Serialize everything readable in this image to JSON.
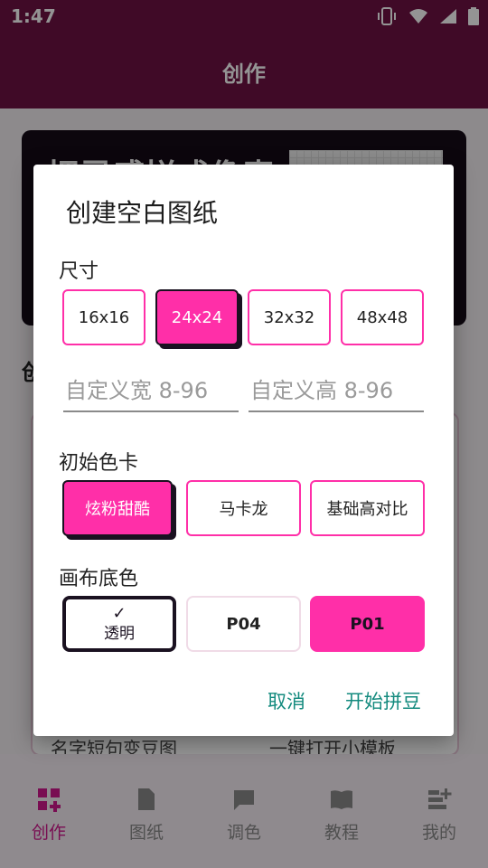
{
  "status": {
    "time": "1:47"
  },
  "app": {
    "title": "创作"
  },
  "background": {
    "hero_text": "把灵感拼成像素",
    "section_heading": "创",
    "card_left": "名字短句变豆图",
    "card_right": "一键打开小模板"
  },
  "dialog": {
    "title": "创建空白图纸",
    "size_label": "尺寸",
    "sizes": [
      "16x16",
      "24x24",
      "32x32",
      "48x48"
    ],
    "selected_size": "24x24",
    "custom_width_placeholder": "自定义宽 8-96",
    "custom_height_placeholder": "自定义高 8-96",
    "palette_label": "初始色卡",
    "palettes": [
      "炫粉甜酷",
      "马卡龙",
      "基础高对比"
    ],
    "selected_palette": "炫粉甜酷",
    "canvas_label": "画布底色",
    "canvas_options": [
      {
        "check": "✓",
        "label": "透明"
      },
      {
        "label": "P04"
      },
      {
        "label": "P01"
      }
    ],
    "cancel": "取消",
    "start": "开始拼豆"
  },
  "bottom_nav": {
    "items": [
      {
        "label": "创作",
        "icon": "grid-plus-icon",
        "active": true
      },
      {
        "label": "图纸",
        "icon": "document-icon",
        "active": false
      },
      {
        "label": "调色",
        "icon": "chat-bubble-icon",
        "active": false
      },
      {
        "label": "教程",
        "icon": "book-icon",
        "active": false
      },
      {
        "label": "我的",
        "icon": "profile-add-icon",
        "active": false
      }
    ]
  },
  "colors": {
    "primary": "#6e1244",
    "accent_pink": "#ff2fa8",
    "action_teal": "#138a7e",
    "nav_active": "#d0178d"
  }
}
